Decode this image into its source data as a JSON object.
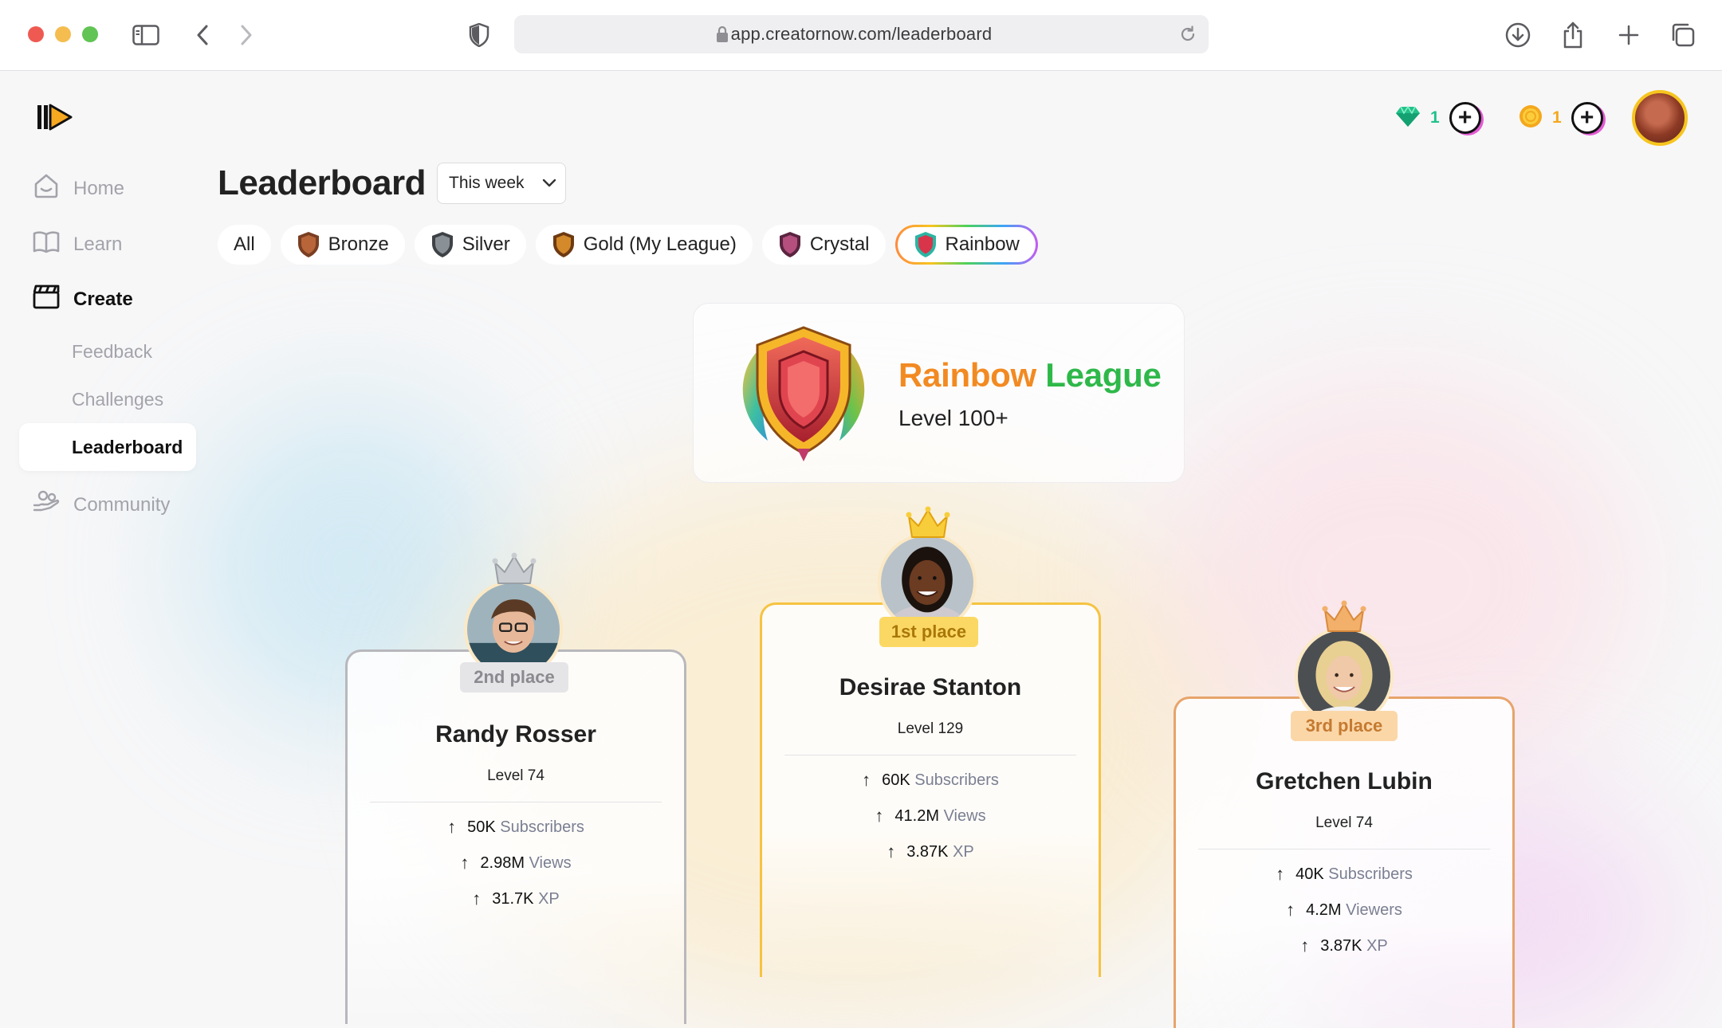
{
  "browser": {
    "url": "app.creatornow.com/leaderboard"
  },
  "header": {
    "gems": "1",
    "coins": "1",
    "plus": "+"
  },
  "sidebar": {
    "items": [
      {
        "label": "Home"
      },
      {
        "label": "Learn"
      },
      {
        "label": "Create"
      },
      {
        "label": "Community"
      }
    ],
    "create_sub": [
      {
        "label": "Feedback"
      },
      {
        "label": "Challenges"
      },
      {
        "label": "Leaderboard"
      }
    ]
  },
  "main": {
    "title": "Leaderboard",
    "period": "This week",
    "tabs": [
      {
        "label": "All"
      },
      {
        "label": "Bronze"
      },
      {
        "label": "Silver"
      },
      {
        "label": "Gold (My League)"
      },
      {
        "label": "Crystal"
      },
      {
        "label": "Rainbow"
      }
    ],
    "league": {
      "name_part1": "Rainbow",
      "name_part2": "League",
      "level": "Level 100+"
    },
    "podium": {
      "first": {
        "place": "1st place",
        "name": "Desirae Stanton",
        "level": "Level 129",
        "stats": [
          {
            "value": "60K",
            "label": "Subscribers"
          },
          {
            "value": "41.2M",
            "label": "Views"
          },
          {
            "value": "3.87K",
            "label": "XP"
          }
        ]
      },
      "second": {
        "place": "2nd place",
        "name": "Randy Rosser",
        "level": "Level 74",
        "stats": [
          {
            "value": "50K",
            "label": "Subscribers"
          },
          {
            "value": "2.98M",
            "label": "Views"
          },
          {
            "value": "31.7K",
            "label": "XP"
          }
        ]
      },
      "third": {
        "place": "3rd place",
        "name": "Gretchen Lubin",
        "level": "Level 74",
        "stats": [
          {
            "value": "40K",
            "label": "Subscribers"
          },
          {
            "value": "4.2M",
            "label": "Viewers"
          },
          {
            "value": "3.87K",
            "label": "XP"
          }
        ]
      }
    }
  },
  "colors": {
    "gold": "#f6c341",
    "silver": "#b8b8bc",
    "bronze": "#e7a46b",
    "gem": "#21c28a",
    "coin": "#f4a81d"
  },
  "icons": [
    "sidebar-toggle-icon",
    "back-icon",
    "forward-icon",
    "shield-privacy-icon",
    "lock-icon",
    "reload-icon",
    "download-icon",
    "share-icon",
    "new-tab-icon",
    "tabs-icon",
    "home-icon",
    "book-icon",
    "clapperboard-icon",
    "community-icon",
    "gem-icon",
    "coin-icon",
    "crown-icon",
    "arrow-up-icon"
  ]
}
